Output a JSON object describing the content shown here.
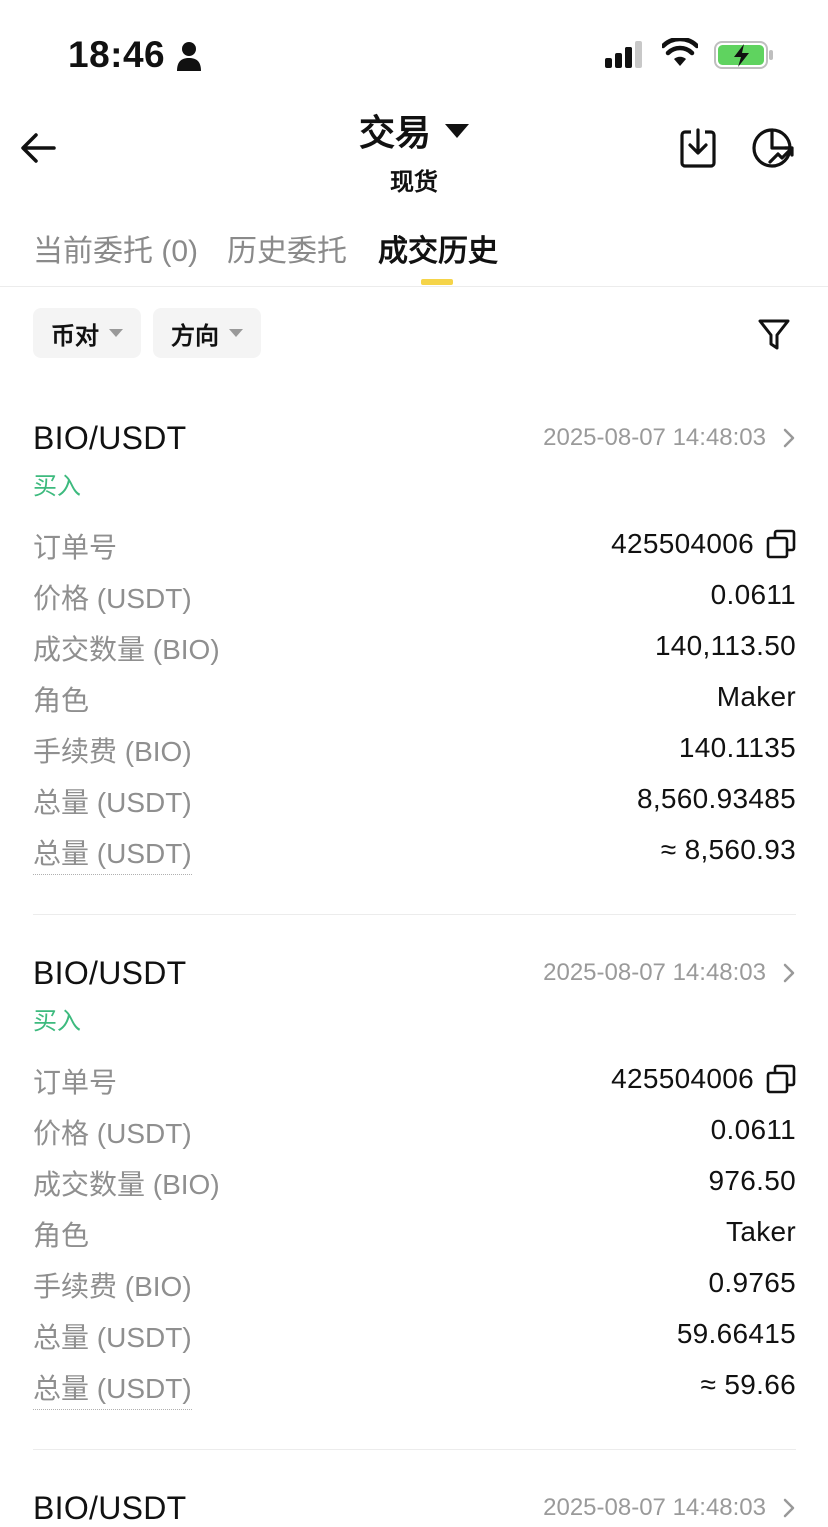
{
  "status_bar": {
    "time": "18:46",
    "icons": [
      "person-icon",
      "signal-icon",
      "wifi-icon",
      "battery-charging-icon"
    ]
  },
  "header": {
    "title": "交易",
    "subtitle": "现货",
    "icons": [
      "back-arrow-icon",
      "title-caret-icon",
      "download-icon",
      "pie-chart-arrow-icon"
    ]
  },
  "tabs": [
    {
      "label": "当前委托 (0)"
    },
    {
      "label": "历史委托"
    },
    {
      "label": "成交历史"
    }
  ],
  "active_tab": "成交历史",
  "filters": {
    "chips": [
      {
        "label": "币对"
      },
      {
        "label": "方向"
      }
    ],
    "filter_icon": "filter-funnel-icon"
  },
  "records": [
    {
      "pair": "BIO/USDT",
      "time": "2025-08-07 14:48:03",
      "side": "买入",
      "rows": [
        {
          "label": "订单号",
          "value": "425504006"
        },
        {
          "label": "价格 (USDT)",
          "value": "0.0611"
        },
        {
          "label": "成交数量 (BIO)",
          "value": "140,113.50"
        },
        {
          "label": "角色",
          "value": "Maker"
        },
        {
          "label": "手续费 (BIO)",
          "value": "140.1135"
        },
        {
          "label": "总量 (USDT)",
          "value": "8,560.93485"
        },
        {
          "label": "总量 (USDT)",
          "value": "≈ 8,560.93"
        }
      ]
    },
    {
      "pair": "BIO/USDT",
      "time": "2025-08-07 14:48:03",
      "side": "买入",
      "rows": [
        {
          "label": "订单号",
          "value": "425504006"
        },
        {
          "label": "价格 (USDT)",
          "value": "0.0611"
        },
        {
          "label": "成交数量 (BIO)",
          "value": "976.50"
        },
        {
          "label": "角色",
          "value": "Taker"
        },
        {
          "label": "手续费 (BIO)",
          "value": "0.9765"
        },
        {
          "label": "总量 (USDT)",
          "value": "59.66415"
        },
        {
          "label": "总量 (USDT)",
          "value": "≈ 59.66"
        }
      ]
    },
    {
      "pair": "BIO/USDT",
      "time": "2025-08-07 14:48:03"
    }
  ],
  "colors": {
    "accent_yellow": "#f5d449",
    "buy_green": "#3dba7e",
    "muted_text": "#8f8f8f",
    "battery_green": "#5fd35f"
  }
}
